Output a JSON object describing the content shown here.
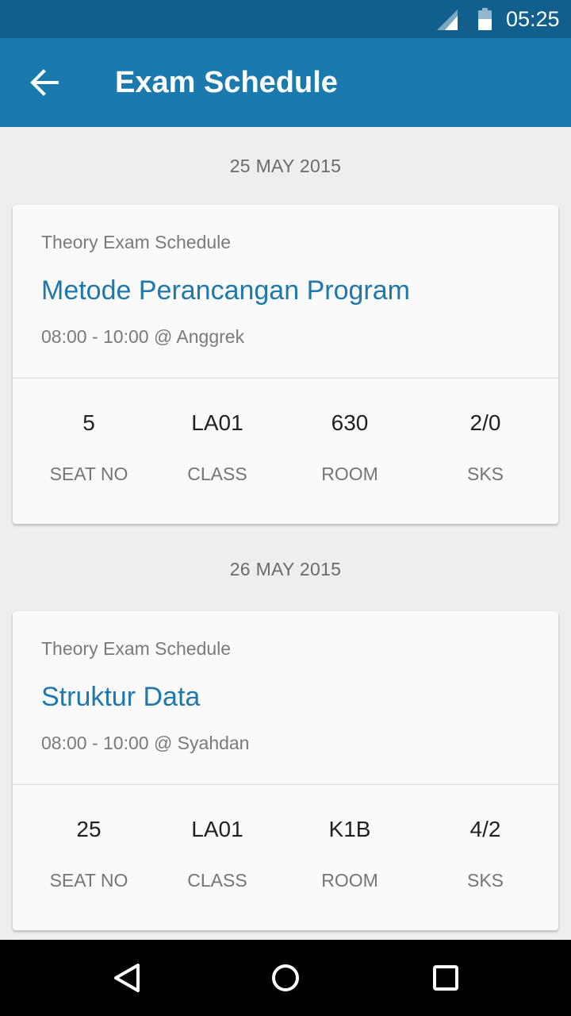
{
  "status_bar": {
    "time": "05:25",
    "icons": [
      "signal-icon",
      "battery-icon"
    ]
  },
  "app_bar": {
    "title": "Exam Schedule",
    "back_icon": "arrow-back-icon"
  },
  "days": [
    {
      "date": "25 MAY 2015",
      "card": {
        "kind": "Theory Exam Schedule",
        "course": "Metode Perancangan Program",
        "time_place": "08:00 - 10:00 @ Anggrek",
        "stats": [
          {
            "value": "5",
            "label": "SEAT NO"
          },
          {
            "value": "LA01",
            "label": "CLASS"
          },
          {
            "value": "630",
            "label": "ROOM"
          },
          {
            "value": "2/0",
            "label": "SKS"
          }
        ]
      }
    },
    {
      "date": "26 MAY 2015",
      "card": {
        "kind": "Theory Exam Schedule",
        "course": "Struktur Data",
        "time_place": "08:00 - 10:00 @ Syahdan",
        "stats": [
          {
            "value": "25",
            "label": "SEAT NO"
          },
          {
            "value": "LA01",
            "label": "CLASS"
          },
          {
            "value": "K1B",
            "label": "ROOM"
          },
          {
            "value": "4/2",
            "label": "SKS"
          }
        ]
      }
    }
  ],
  "nav_bar": {
    "icons": [
      "back-triangle-icon",
      "home-circle-icon",
      "recents-square-icon"
    ]
  },
  "colors": {
    "status_bar": "#105f8d",
    "app_bar": "#1a7aad",
    "accent_text": "#1f78ab",
    "background": "#eeeeee"
  }
}
